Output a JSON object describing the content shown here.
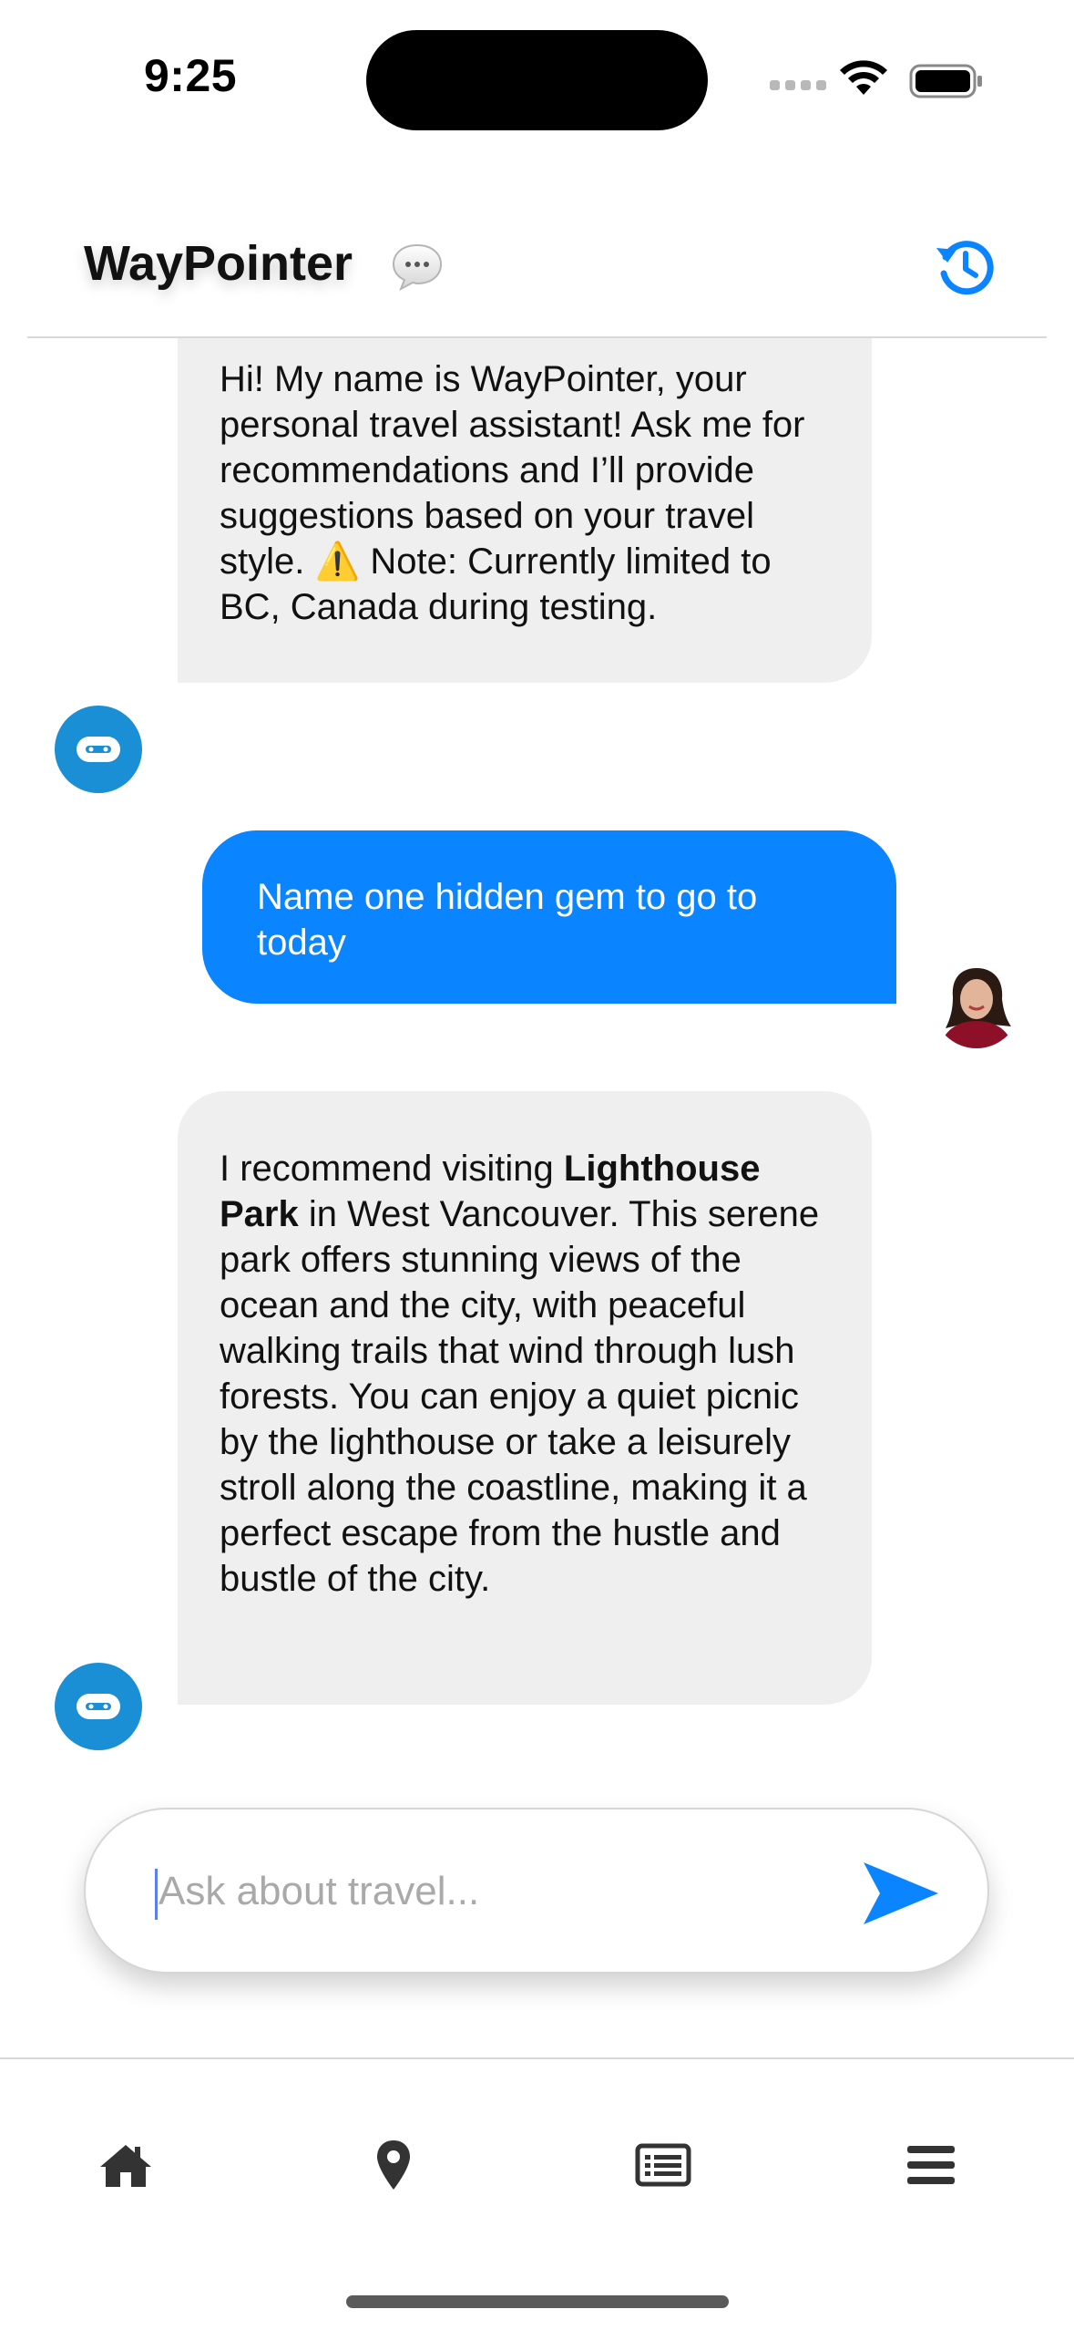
{
  "status_bar": {
    "time": "9:25"
  },
  "header": {
    "title": "WayPointer",
    "chat_icon": "chat-bubble-icon",
    "history_icon": "history-icon",
    "accent_color": "#0a84ff"
  },
  "chat": {
    "messages": [
      {
        "sender": "bot",
        "text_before_warning": "Hi! My name is WayPointer, your personal travel assistant! Ask me for recommendations and I’ll provide suggestions based on your travel style.",
        "warning_icon": "⚠️",
        "text_after_warning": "Note: Currently limited to BC, Canada during testing."
      },
      {
        "sender": "user",
        "text": "Name one hidden gem to go to today"
      },
      {
        "sender": "bot",
        "text_intro": "I recommend visiting",
        "text_bold": "Lighthouse Park",
        "text_rest": "in West Vancouver. This serene park offers stunning views of the ocean and the city, with peaceful walking trails that wind through lush forests. You can enjoy a quiet picnic by the lighthouse or take a leisurely stroll along the coastline, making it a perfect escape from the hustle and bustle of the city."
      }
    ],
    "bot_bubble_color": "#efefef",
    "user_bubble_color": "#0a84ff",
    "bot_avatar_color": "#1a8fd6"
  },
  "input": {
    "placeholder": "Ask about travel...",
    "value": ""
  },
  "tab_bar": {
    "items": [
      {
        "icon": "home-icon"
      },
      {
        "icon": "map-pin-icon"
      },
      {
        "icon": "list-icon"
      },
      {
        "icon": "menu-icon"
      }
    ]
  }
}
